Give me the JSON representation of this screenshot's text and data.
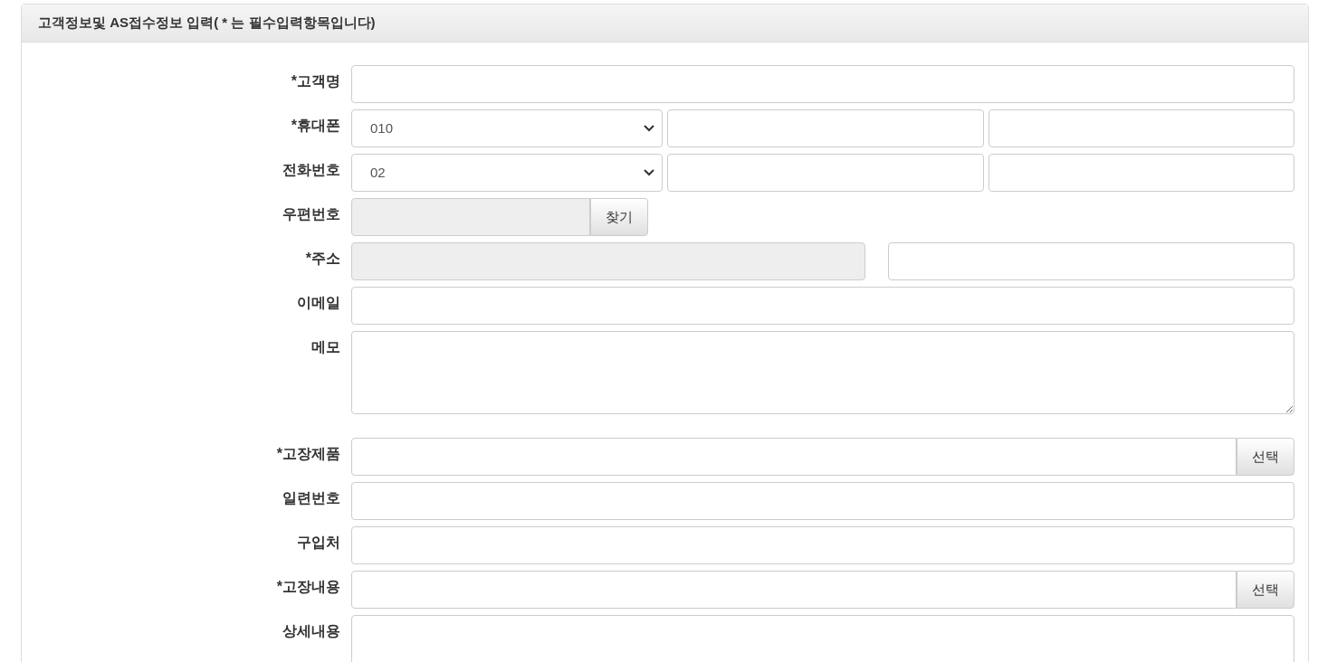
{
  "panel": {
    "title": "고객정보및 AS접수정보 입력( * 는 필수입력항목입니다)"
  },
  "rows": [
    {
      "kind": "text",
      "label": "*고객명"
    },
    {
      "kind": "phone",
      "label": "*휴대폰",
      "select": "010"
    },
    {
      "kind": "phone",
      "label": "전화번호",
      "select": "02"
    },
    {
      "kind": "zip",
      "label": "우편번호",
      "button": "찾기"
    },
    {
      "kind": "address",
      "label": "*주소"
    },
    {
      "kind": "text",
      "label": "이메일"
    },
    {
      "kind": "textarea",
      "label": "메모"
    },
    {
      "kind": "search",
      "label": "*고장제품",
      "button": "선택"
    },
    {
      "kind": "text",
      "label": "일련번호"
    },
    {
      "kind": "text",
      "label": "구입처"
    },
    {
      "kind": "search",
      "label": "*고장내용",
      "button": "선택"
    },
    {
      "kind": "textarea",
      "label": "상세내용"
    }
  ]
}
